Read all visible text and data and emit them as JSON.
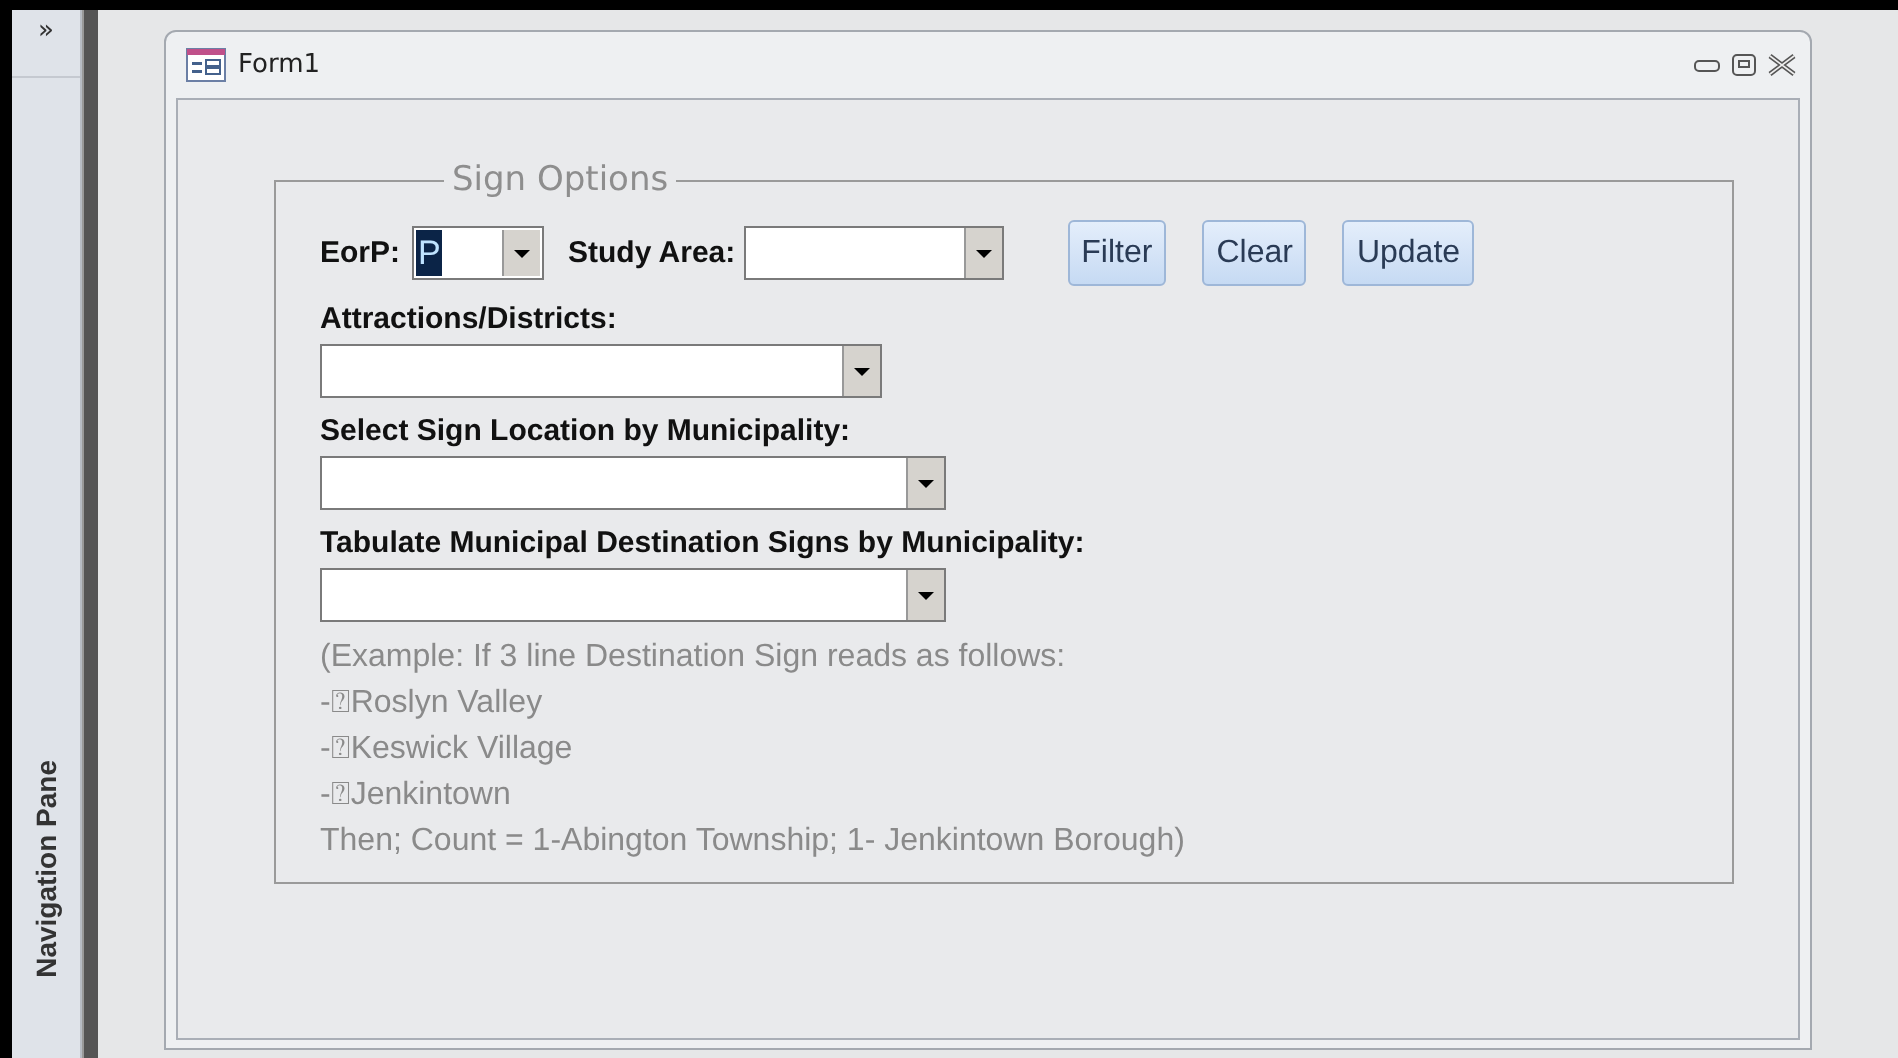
{
  "navigation_pane": {
    "expand_button": "»",
    "title": "Navigation Pane"
  },
  "form_window": {
    "title": "Form1"
  },
  "group": {
    "legend": "Sign Options",
    "eorp": {
      "label": "EorP:",
      "value": "P",
      "text_selected": true
    },
    "study_area": {
      "label": "Study Area:"
    },
    "buttons": [
      "Filter",
      "Clear",
      "Update"
    ],
    "combos": [
      {
        "label": "Attractions/Districts:"
      },
      {
        "label": "Select Sign Location by Municipality:"
      },
      {
        "label": "Tabulate Municipal Destination Signs by Municipality:"
      }
    ],
    "note_lines": [
      "(Example: If 3 line Destination Sign reads as follows:",
      "-⍰Roslyn Valley",
      "-⍰Keswick Village",
      "-⍰Jenkintown",
      "Then; Count = 1-Abington Township; 1- Jenkintown Borough)"
    ]
  }
}
